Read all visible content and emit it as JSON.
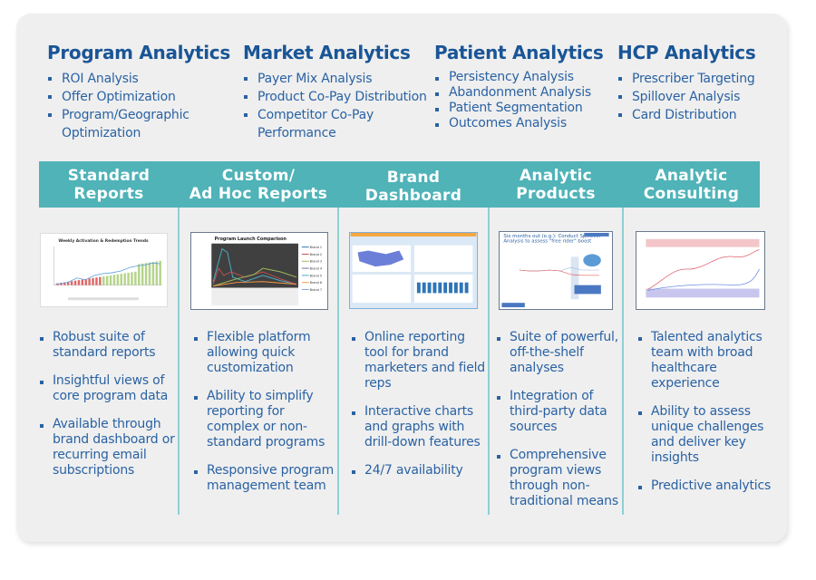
{
  "analytics": [
    {
      "title": "Program Analytics",
      "items": [
        "ROI Analysis",
        "Offer Optimization",
        "Program/Geographic Optimization"
      ]
    },
    {
      "title": "Market Analytics",
      "items": [
        "Payer Mix Analysis",
        "Product Co-Pay Distribution",
        "Competitor Co-Pay Performance"
      ]
    },
    {
      "title": "Patient Analytics",
      "items": [
        "Persistency Analysis",
        "Abandonment Analysis",
        "Patient Segmentation",
        "Outcomes Analysis"
      ]
    },
    {
      "title": "HCP Analytics",
      "items": [
        "Prescriber Targeting",
        "Spillover Analysis",
        "Card Distribution"
      ]
    }
  ],
  "colors": {
    "heading": "#1a5596",
    "text": "#2a62a3",
    "band": "#4fb3b8"
  },
  "offerings": [
    {
      "title_line1": "Standard",
      "title_line2": "Reports",
      "thumb_title": "Weekly Activation & Redemption Trends",
      "bullets": [
        "Robust suite of standard reports",
        "Insightful views of core program data",
        "Available through brand dashboard or recurring email subscriptions"
      ]
    },
    {
      "title_line1": "Custom/",
      "title_line2": "Ad Hoc Reports",
      "thumb_title": "Program Launch Comparison",
      "thumb_legend": [
        "Brand 1",
        "Brand 2",
        "Brand 3",
        "Brand 4",
        "Brand 5",
        "Brand 6",
        "Brand 7"
      ],
      "bullets": [
        "Flexible platform allowing quick customization",
        "Ability to simplify reporting for complex or non-standard programs",
        "Responsive program management team"
      ]
    },
    {
      "title_line1": "Brand",
      "title_line2": "Dashboard",
      "bullets": [
        "Online reporting tool for brand marketers and field reps",
        "Interactive charts and graphs with drill-down features",
        "24/7 availability"
      ]
    },
    {
      "title_line1": "Analytic",
      "title_line2": "Products",
      "thumb_title": "Six months out (e.g.): Conduct Spillover Analysis to assess \"free rider\" boost",
      "bullets": [
        "Suite of powerful, off-the-shelf analyses",
        "Integration of third-party data sources",
        "Comprehensive program views through non-traditional means"
      ]
    },
    {
      "title_line1": "Analytic",
      "title_line2": "Consulting",
      "bullets": [
        "Talented analytics team with broad healthcare experience",
        "Ability to assess unique challenges and deliver key insights",
        "Predictive analytics"
      ]
    }
  ]
}
